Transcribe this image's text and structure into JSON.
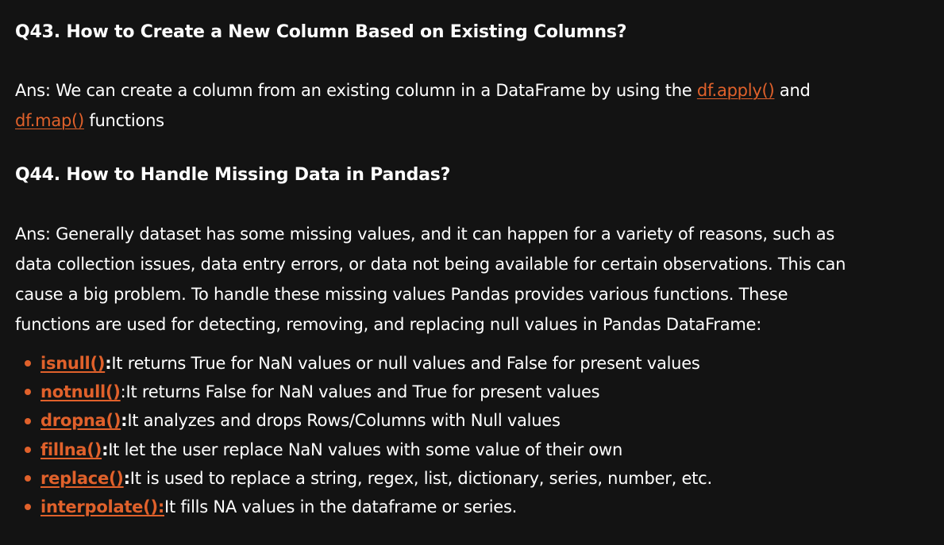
{
  "q43": {
    "heading": "Q43. How to Create a New Column Based on Existing Columns?",
    "answer_prefix": "Ans: We can create a column from an existing column in a DataFrame by using the ",
    "link1": "df.apply()",
    "answer_mid": " and ",
    "link2": "df.map()",
    "answer_suffix": " functions"
  },
  "q44": {
    "heading": "Q44. How to Handle Missing Data in Pandas?",
    "answer": "Ans: Generally dataset has some missing values, and it can happen for a variety of reasons, such as data collection issues, data entry errors, or data not being available for certain observations. This can cause a big problem. To handle these missing values Pandas provides various functions. These functions are used for detecting, removing, and replacing null values in Pandas DataFrame:",
    "items": [
      {
        "fn": "isnull()",
        "sep": ":",
        "desc": " It returns True for NaN values or null values and False for present values"
      },
      {
        "fn": "notnull()",
        "sep": ":",
        "desc": " It returns False for NaN values and True for present values"
      },
      {
        "fn": "dropna()",
        "sep": ":",
        "desc": " It analyzes and drops Rows/Columns with Null values"
      },
      {
        "fn": "fillna()",
        "sep": ":",
        "desc": " It let the user replace NaN values with some value of their own"
      },
      {
        "fn": "replace()",
        "sep": ":",
        "desc": " It is used to replace a string, regex, list, dictionary, series, number, etc."
      },
      {
        "fn": "interpolate():",
        "sep": "",
        "desc": " It fills NA values in the dataframe or series."
      }
    ]
  },
  "colors": {
    "background": "#131313",
    "text": "#ffffff",
    "accent": "#e0612b"
  }
}
